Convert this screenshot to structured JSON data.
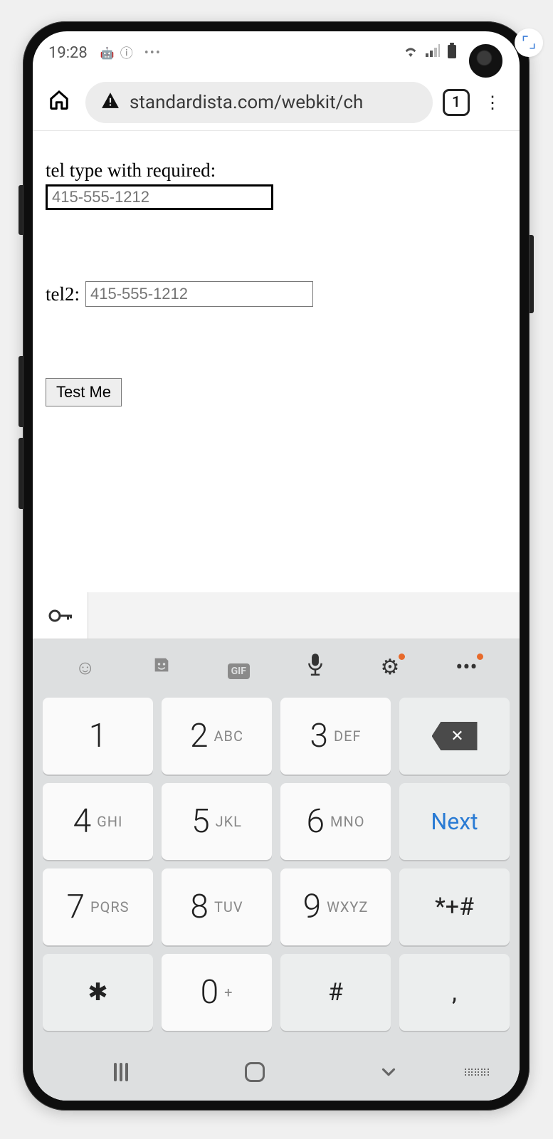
{
  "statusbar": {
    "time": "19:28",
    "icons_left": [
      "android-icon",
      "info-icon",
      "swirl-icon",
      "more-icon"
    ],
    "icons_right": [
      "wifi-icon",
      "signal-icon",
      "battery-icon"
    ]
  },
  "browser": {
    "url": "standardista.com/webkit/ch",
    "tab_count": "1"
  },
  "page": {
    "field1_label": "tel type with required:",
    "field1_placeholder": "415-555-1212",
    "field2_label": "tel2:",
    "field2_placeholder": "415-555-1212",
    "button_label": "Test Me"
  },
  "keyboard": {
    "toolbar": [
      "emoji-icon",
      "sticker-icon",
      "gif-icon",
      "mic-icon",
      "gear-icon",
      "more-icon"
    ],
    "gif_label": "GIF",
    "next_label": "Next",
    "keys": [
      {
        "num": "1",
        "letters": ""
      },
      {
        "num": "2",
        "letters": "ABC"
      },
      {
        "num": "3",
        "letters": "DEF"
      },
      {
        "action": "backspace"
      },
      {
        "num": "4",
        "letters": "GHI"
      },
      {
        "num": "5",
        "letters": "JKL"
      },
      {
        "num": "6",
        "letters": "MNO"
      },
      {
        "action": "next"
      },
      {
        "num": "7",
        "letters": "PQRS"
      },
      {
        "num": "8",
        "letters": "TUV"
      },
      {
        "num": "9",
        "letters": "WXYZ"
      },
      {
        "sym": "*+#"
      },
      {
        "sym": "✱"
      },
      {
        "num": "0",
        "letters": "+"
      },
      {
        "sym": "#"
      },
      {
        "sym": ","
      }
    ]
  },
  "navbar": [
    "recents-icon",
    "home-icon",
    "back-icon",
    "keyboard-hide-icon"
  ]
}
